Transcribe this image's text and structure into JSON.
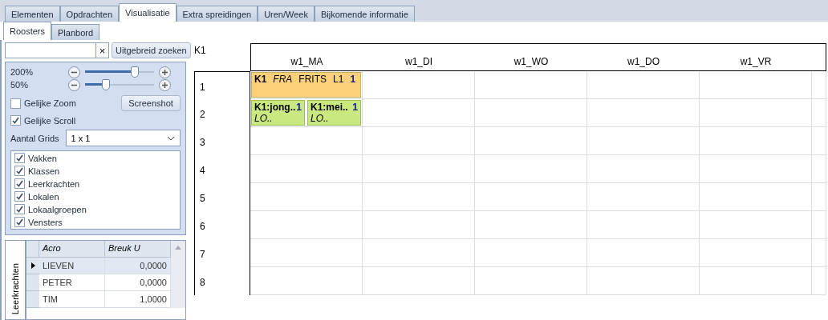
{
  "tabs": [
    {
      "label": "Elementen",
      "selected": false
    },
    {
      "label": "Opdrachten",
      "selected": false
    },
    {
      "label": "Visualisatie",
      "selected": true
    },
    {
      "label": "Extra spreidingen",
      "selected": false
    },
    {
      "label": "Uren/Week",
      "selected": false
    },
    {
      "label": "Bijkomende informatie",
      "selected": false
    }
  ],
  "subtabs": [
    {
      "label": "Roosters",
      "selected": true
    },
    {
      "label": "Planbord",
      "selected": false
    }
  ],
  "search": {
    "clear": "×",
    "button": "Uitgebreid zoeken"
  },
  "zoom": {
    "sliders": [
      {
        "label": "200%",
        "level": 0.72
      },
      {
        "label": "50%",
        "level": 0.3
      }
    ]
  },
  "options": [
    {
      "label": "Gelijke Zoom",
      "checked": false
    },
    {
      "label": "Gelijke Scroll",
      "checked": true
    }
  ],
  "screenshot_button": "Screenshot",
  "grids": {
    "label": "Aantal Grids",
    "value": "1 x 1"
  },
  "layers": [
    {
      "label": "Vakken",
      "checked": true
    },
    {
      "label": "Klassen",
      "checked": true
    },
    {
      "label": "Leerkrachten",
      "checked": true
    },
    {
      "label": "Lokalen",
      "checked": true
    },
    {
      "label": "Lokaalgroepen",
      "checked": true
    },
    {
      "label": "Vensters",
      "checked": true
    }
  ],
  "side_tab": "Leerkrachten",
  "table": {
    "columns": [
      "Acro",
      "Breuk U"
    ],
    "rows": [
      {
        "acro": "LIEVEN",
        "value": "0,0000",
        "selected": true
      },
      {
        "acro": "PETER",
        "value": "0,0000",
        "selected": false
      },
      {
        "acro": "TIM",
        "value": "1,0000",
        "selected": false
      }
    ]
  },
  "schedule": {
    "title": "K1",
    "days": [
      "w1_MA",
      "w1_DI",
      "w1_WO",
      "w1_DO",
      "w1_VR"
    ],
    "periods": [
      {
        "label": "1",
        "lessons": [
          {
            "kind": "full",
            "color": "#fdd17a",
            "class": "K1",
            "subject": "FRA",
            "teacher": "FRITS",
            "room": "L1",
            "count": "1"
          }
        ]
      },
      {
        "label": "2",
        "lessons": [
          {
            "kind": "split",
            "color": "#c9e87f",
            "class": "K1:jong..",
            "count": "1",
            "subject": "LO.."
          },
          {
            "kind": "split",
            "color": "#c9e87f",
            "class": "K1:mei..",
            "count": "1",
            "subject": "LO.."
          }
        ]
      },
      {
        "label": "3"
      },
      {
        "label": "4"
      },
      {
        "label": "5"
      },
      {
        "label": "6"
      },
      {
        "label": "7"
      },
      {
        "label": "8"
      }
    ]
  }
}
